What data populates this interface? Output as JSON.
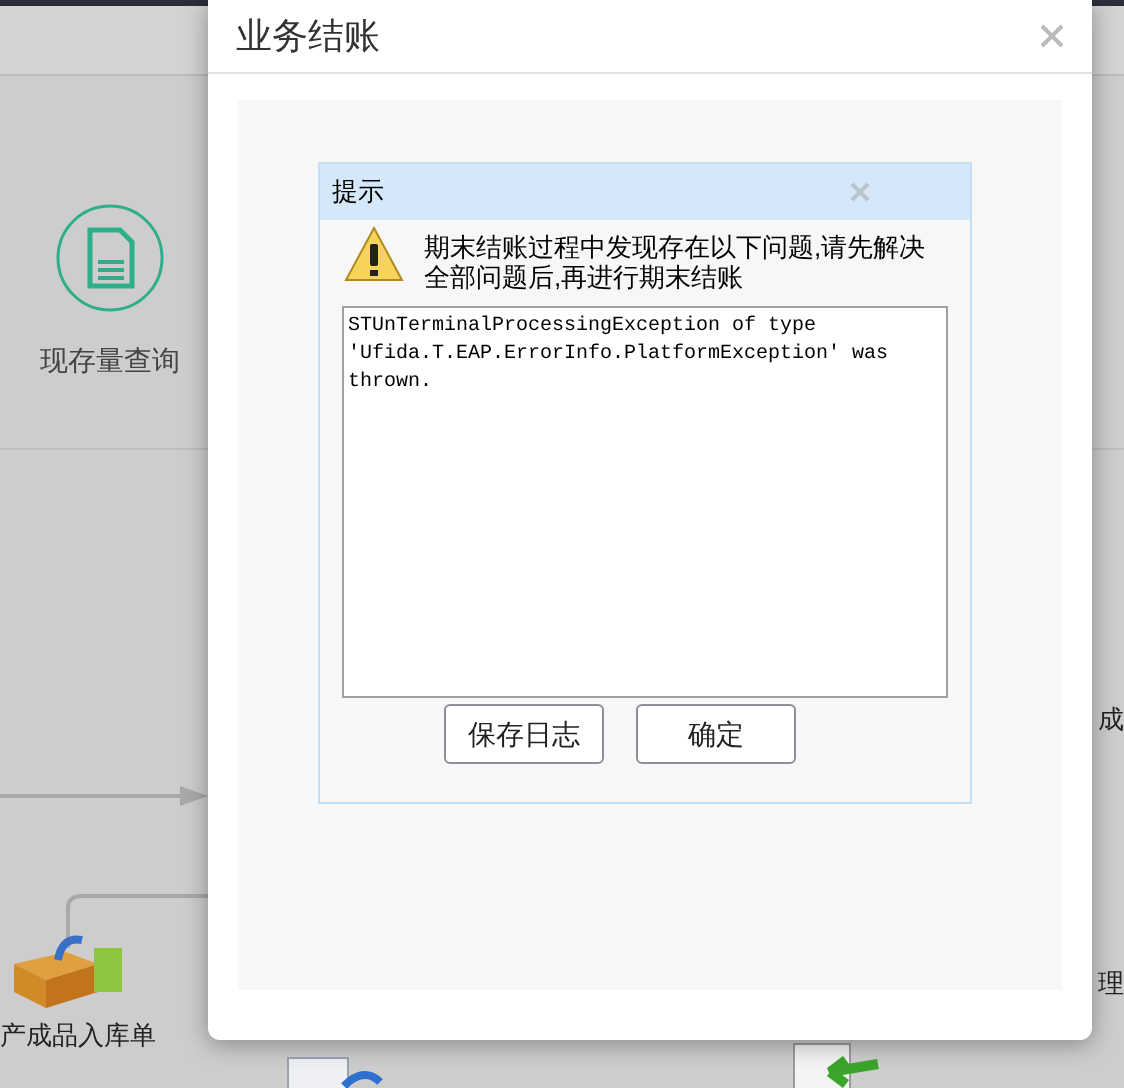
{
  "background": {
    "items": [
      {
        "label": "现存量查询",
        "kind": "document"
      },
      {
        "label": "产成品入库单",
        "kind": "box"
      },
      {
        "label": "成",
        "kind": "partial"
      },
      {
        "label": "理",
        "kind": "partial"
      }
    ]
  },
  "dialog": {
    "title": "业务结账"
  },
  "message_box": {
    "title": "提示",
    "message": "期末结账过程中发现存在以下问题,请先解决全部问题后,再进行期末结账",
    "details": [
      "STUnTerminalProcessingException of type",
      "'Ufida.T.EAP.ErrorInfo.PlatformException' was",
      "thrown."
    ],
    "buttons": [
      "保存日志",
      "确定"
    ]
  }
}
